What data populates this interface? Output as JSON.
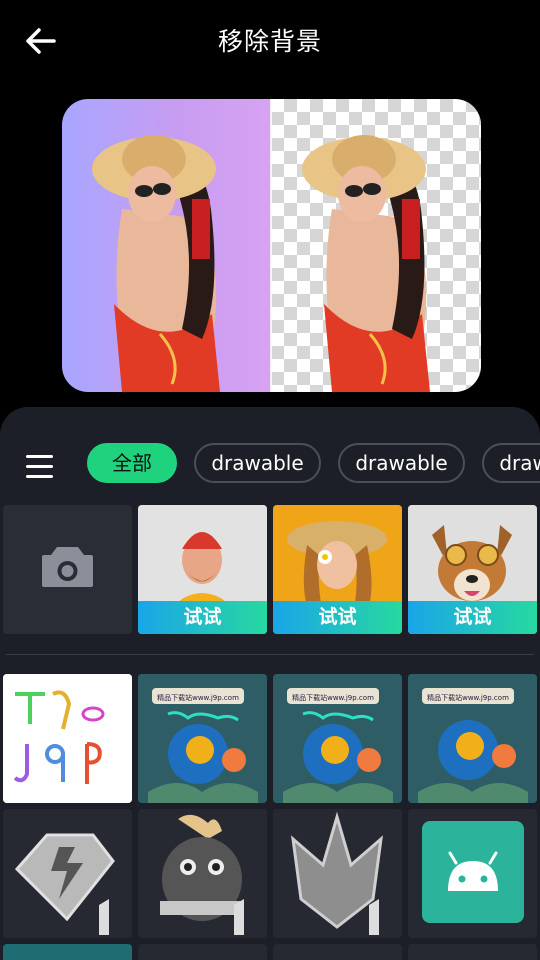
{
  "header": {
    "title": "移除背景",
    "back_icon": "arrow-left-icon"
  },
  "preview": {
    "left_bg": "#b4a2f8",
    "right_bg": "transparent-checker"
  },
  "panel": {
    "menu_icon": "hamburger-menu-icon",
    "chips": [
      {
        "label": "全部",
        "active": true
      },
      {
        "label": "drawable",
        "active": false
      },
      {
        "label": "drawable",
        "active": false
      },
      {
        "label": "drawable",
        "active": false
      }
    ],
    "camera_icon": "camera-icon",
    "samples": [
      {
        "subject": "smiling man in red beanie",
        "button": "试试"
      },
      {
        "subject": "woman in straw hat with flower",
        "button": "试试"
      },
      {
        "subject": "dog with sunglasses",
        "button": "试试"
      }
    ],
    "assets_row1": [
      {
        "caption": "精品下载站www.j9p.com"
      },
      {
        "caption": "精品下载站www.j9p.com"
      },
      {
        "caption": "精品下载站www.j9p.com"
      }
    ],
    "logo_text": "j9p",
    "accent_color": "#1fd37e"
  }
}
